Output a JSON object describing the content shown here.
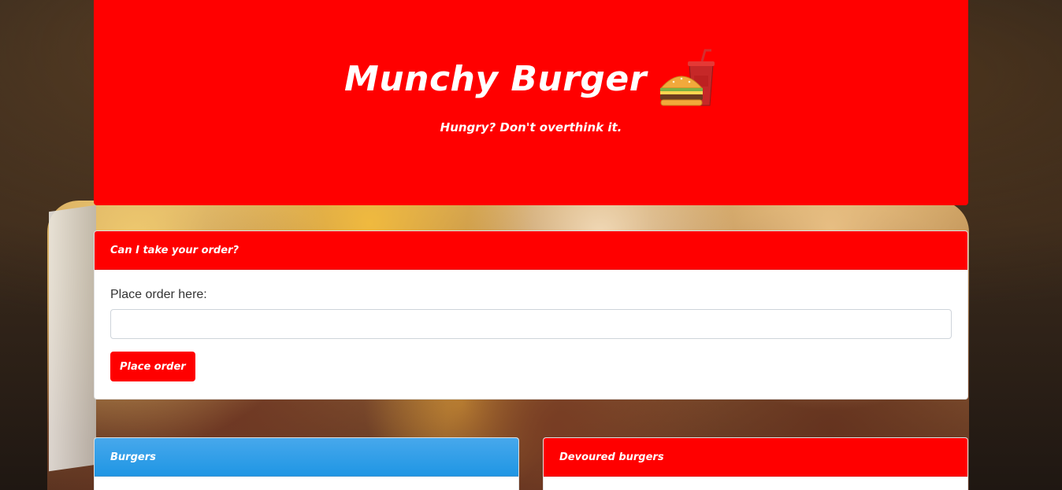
{
  "header": {
    "title": "Munchy Burger",
    "icon": "burger-and-drink-icon",
    "tagline": "Hungry? Don't overthink it."
  },
  "order_form": {
    "header": "Can I take your order?",
    "label": "Place order here:",
    "input_value": "",
    "input_placeholder": "",
    "button_label": "Place order"
  },
  "burgers_panel": {
    "header": "Burgers"
  },
  "devoured_panel": {
    "header": "Devoured burgers"
  },
  "colors": {
    "brand_red": "#ff0000",
    "burgers_header_blue": "#1f96e4"
  }
}
